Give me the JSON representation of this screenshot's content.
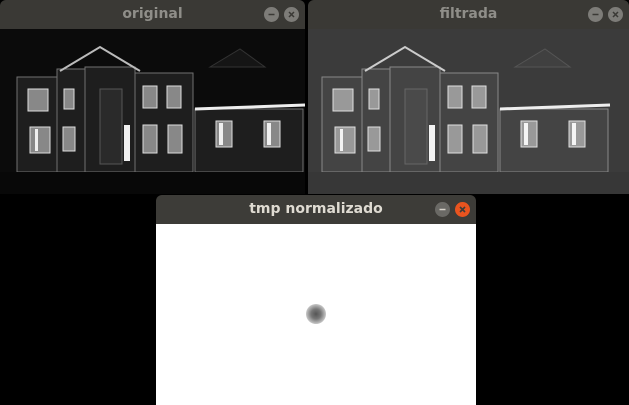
{
  "windows": {
    "original": {
      "title": "original"
    },
    "filtered": {
      "title": "filtrada"
    },
    "normalized": {
      "title": "tmp normalizado"
    }
  },
  "icons": {
    "minimize": "minimize-icon",
    "close": "close-icon"
  },
  "colors": {
    "close_active": "#e9541f",
    "titlebar": "#3a3935"
  }
}
